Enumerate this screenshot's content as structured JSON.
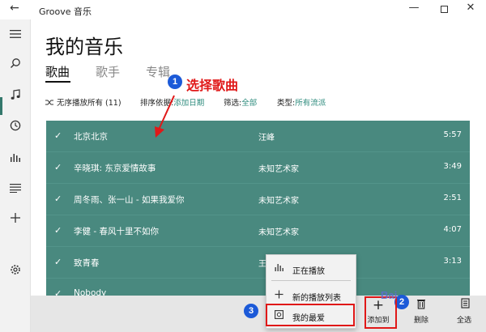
{
  "window": {
    "title": "Groove 音乐",
    "back_glyph": "←",
    "minimize_glyph": "—",
    "close_glyph": "✕"
  },
  "rail": {
    "icons": [
      "hamburger-icon",
      "search-icon",
      "music-note-icon",
      "recent-icon",
      "chart-icon",
      "playlist-icon",
      "add-icon",
      "settings-icon"
    ]
  },
  "page": {
    "title": "我的音乐",
    "tabs": [
      {
        "label": "歌曲",
        "active": true
      },
      {
        "label": "歌手",
        "active": false
      },
      {
        "label": "专辑",
        "active": false
      }
    ]
  },
  "filters": {
    "shuffle_label": "无序播放所有 (11)",
    "sort_label": "排序依据:",
    "sort_value": "添加日期",
    "filter_label": "筛选:",
    "filter_value": "全部",
    "type_label": "类型:",
    "type_value": "所有流派"
  },
  "songs": [
    {
      "title": "北京北京",
      "artist": "汪峰",
      "duration": "5:57"
    },
    {
      "title": "辛晓琪: 东京爱情故事",
      "artist": "未知艺术家",
      "duration": "3:49"
    },
    {
      "title": "周冬雨、张一山 - 如果我爱你",
      "artist": "未知艺术家",
      "duration": "2:51"
    },
    {
      "title": "李健 - 春风十里不如你",
      "artist": "未知艺术家",
      "duration": "4:07"
    },
    {
      "title": "致青春",
      "artist": "王",
      "duration": "3:13"
    },
    {
      "title": "Nobody",
      "artist": "",
      "duration": ""
    }
  ],
  "flyout": {
    "items": [
      "正在播放",
      "新的播放列表",
      "我的最爱"
    ]
  },
  "commands": {
    "add_to": "添加到",
    "delete": "删除",
    "select_all": "全选"
  },
  "annotations": {
    "step1_number": "1",
    "step1_text": "选择歌曲",
    "step2_number": "2",
    "step3_number": "3",
    "watermark": "Bai"
  },
  "colors": {
    "accent": "#2f8c7e",
    "list_bg": "#49897f",
    "annotation_red": "#e01818",
    "badge_blue": "#1c5ad8"
  }
}
